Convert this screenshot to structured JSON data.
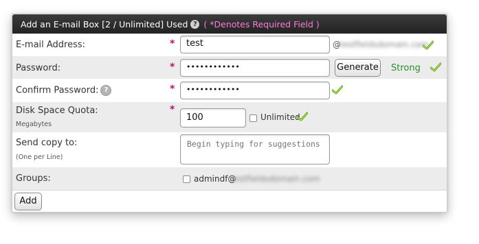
{
  "title": {
    "text": "Add an E-mail Box [2 / Unlimited] Used",
    "required_note": "( *Denotes Required Field )"
  },
  "required_marker": "*",
  "fields": {
    "email": {
      "label": "E-mail Address:",
      "value": "test",
      "at": "@",
      "domain": "testfieldsdomain.com"
    },
    "password": {
      "label": "Password:",
      "value": "••••••••••••",
      "generate_label": "Generate",
      "strength": "Strong"
    },
    "confirm": {
      "label": "Confirm Password:",
      "value": "••••••••••••"
    },
    "quota": {
      "label": "Disk Space Quota:",
      "sublabel": "Megabytes",
      "value": "100",
      "unlimited_label": "Unlimited"
    },
    "copy": {
      "label": "Send copy to:",
      "sublabel": "(One per Line)",
      "placeholder": "Begin typing for suggestions"
    },
    "groups": {
      "label": "Groups:",
      "option": "admindf@",
      "option_blurred": "testfieldsdomain.com"
    }
  },
  "add_label": "Add",
  "colors": {
    "strong": "#2a8a2a",
    "required": "#b0146a",
    "title_note": "#ff7ad9"
  }
}
